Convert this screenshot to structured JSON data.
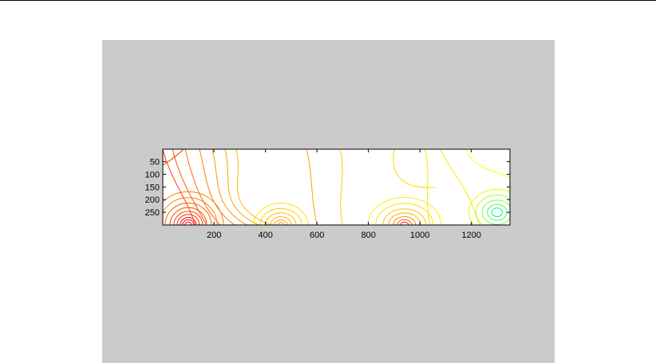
{
  "window": {
    "top_rule": true
  },
  "chart_data": {
    "type": "contour",
    "title": "",
    "xlabel": "",
    "ylabel": "",
    "xlim": [
      1,
      1350
    ],
    "ylim": [
      300,
      1
    ],
    "y_reversed": true,
    "xticks": [
      200,
      400,
      600,
      800,
      1000,
      1200
    ],
    "yticks": [
      50,
      100,
      150,
      200,
      250
    ],
    "colormap": "autumn-to-green",
    "background": "#cbcbcb",
    "colors": {
      "low": "#ff0000",
      "mid_low": "#ff7f00",
      "mid": "#ffcc00",
      "mid_high": "#ffff00",
      "high": "#00ff7f"
    },
    "hotspots": [
      {
        "label": "red source left",
        "x": 100,
        "y": 295
      },
      {
        "label": "orange source 460",
        "x": 460,
        "y": 295
      },
      {
        "label": "orange source 940",
        "x": 940,
        "y": 295
      },
      {
        "label": "green minimum right",
        "x": 1300,
        "y": 250
      }
    ]
  }
}
